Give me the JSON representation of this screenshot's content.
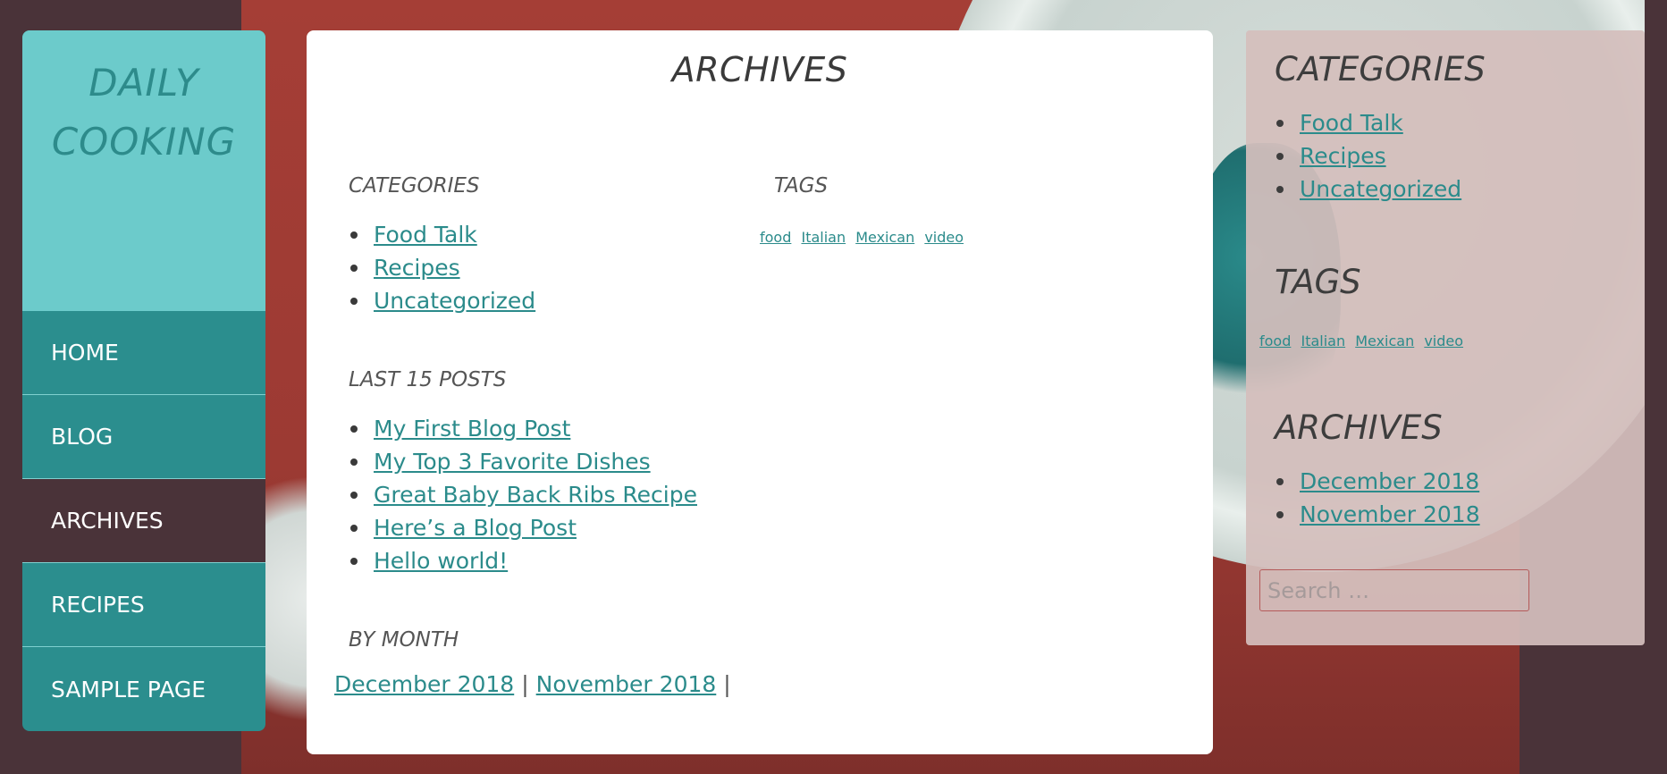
{
  "brand": {
    "line1": "DAILY",
    "line2": "COOKING"
  },
  "nav": [
    {
      "label": "HOME"
    },
    {
      "label": "BLOG"
    },
    {
      "label": "ARCHIVES",
      "active": true
    },
    {
      "label": "RECIPES"
    },
    {
      "label": "SAMPLE PAGE"
    }
  ],
  "main": {
    "title": "ARCHIVES",
    "categories": {
      "heading": "CATEGORIES",
      "items": [
        "Food Talk",
        "Recipes",
        "Uncategorized"
      ]
    },
    "tags": {
      "heading": "TAGS",
      "items": [
        "food",
        "Italian",
        "Mexican",
        "video"
      ]
    },
    "last_posts": {
      "heading": "LAST 15 POSTS",
      "items": [
        "My First Blog Post",
        "My Top 3 Favorite Dishes",
        "Great Baby Back Ribs Recipe",
        "Here’s a Blog Post",
        "Hello world!"
      ]
    },
    "by_month": {
      "heading": "BY MONTH",
      "items": [
        "December 2018",
        "November 2018"
      ],
      "separator": "|"
    }
  },
  "sidebar_right": {
    "categories": {
      "heading": "CATEGORIES",
      "items": [
        "Food Talk",
        "Recipes",
        "Uncategorized"
      ]
    },
    "tags": {
      "heading": "TAGS",
      "items": [
        "food",
        "Italian",
        "Mexican",
        "video"
      ]
    },
    "archives": {
      "heading": "ARCHIVES",
      "items": [
        "December 2018",
        "November 2018"
      ]
    },
    "search": {
      "placeholder": "Search …"
    }
  },
  "colors": {
    "accent_teal": "#2b8e8e",
    "brand_bg": "#6ccbcb",
    "active_nav": "#4a3339",
    "link": "#2b8b8b"
  }
}
